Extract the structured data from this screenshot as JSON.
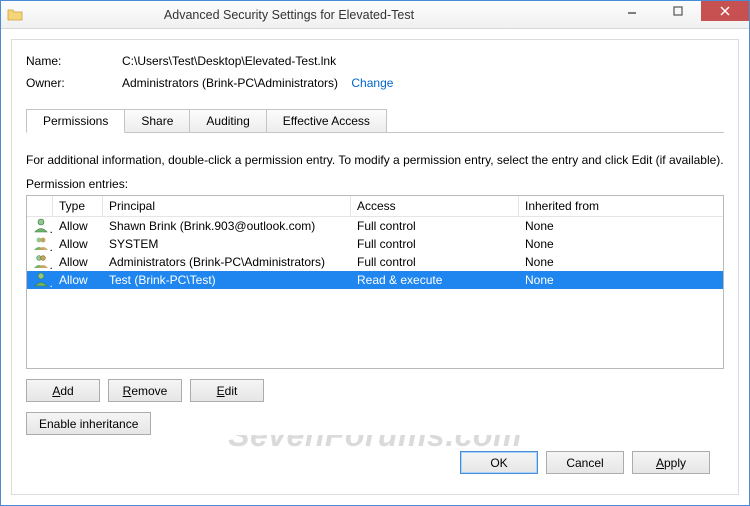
{
  "window": {
    "title": "Advanced Security Settings for Elevated-Test"
  },
  "name": {
    "label": "Name:",
    "value": "C:\\Users\\Test\\Desktop\\Elevated-Test.lnk"
  },
  "owner": {
    "label": "Owner:",
    "value": "Administrators (Brink-PC\\Administrators)",
    "change": "Change"
  },
  "tabs": {
    "permissions": "Permissions",
    "share": "Share",
    "auditing": "Auditing",
    "effective": "Effective Access"
  },
  "hint": "For additional information, double-click a permission entry. To modify a permission entry, select the entry and click Edit (if available).",
  "perm_label": "Permission entries:",
  "columns": {
    "type": "Type",
    "principal": "Principal",
    "access": "Access",
    "inherited": "Inherited from"
  },
  "rows": [
    {
      "icon": "user",
      "type": "Allow",
      "principal": "Shawn Brink (Brink.903@outlook.com)",
      "access": "Full control",
      "inherited": "None",
      "selected": false
    },
    {
      "icon": "system",
      "type": "Allow",
      "principal": "SYSTEM",
      "access": "Full control",
      "inherited": "None",
      "selected": false
    },
    {
      "icon": "group",
      "type": "Allow",
      "principal": "Administrators (Brink-PC\\Administrators)",
      "access": "Full control",
      "inherited": "None",
      "selected": false
    },
    {
      "icon": "user",
      "type": "Allow",
      "principal": "Test (Brink-PC\\Test)",
      "access": "Read & execute",
      "inherited": "None",
      "selected": true
    }
  ],
  "buttons": {
    "add": "Add",
    "remove": "Remove",
    "edit": "Edit",
    "enable_inh": "Enable inheritance",
    "ok": "OK",
    "cancel": "Cancel",
    "apply": "Apply"
  },
  "watermark": "SevenForums.com"
}
